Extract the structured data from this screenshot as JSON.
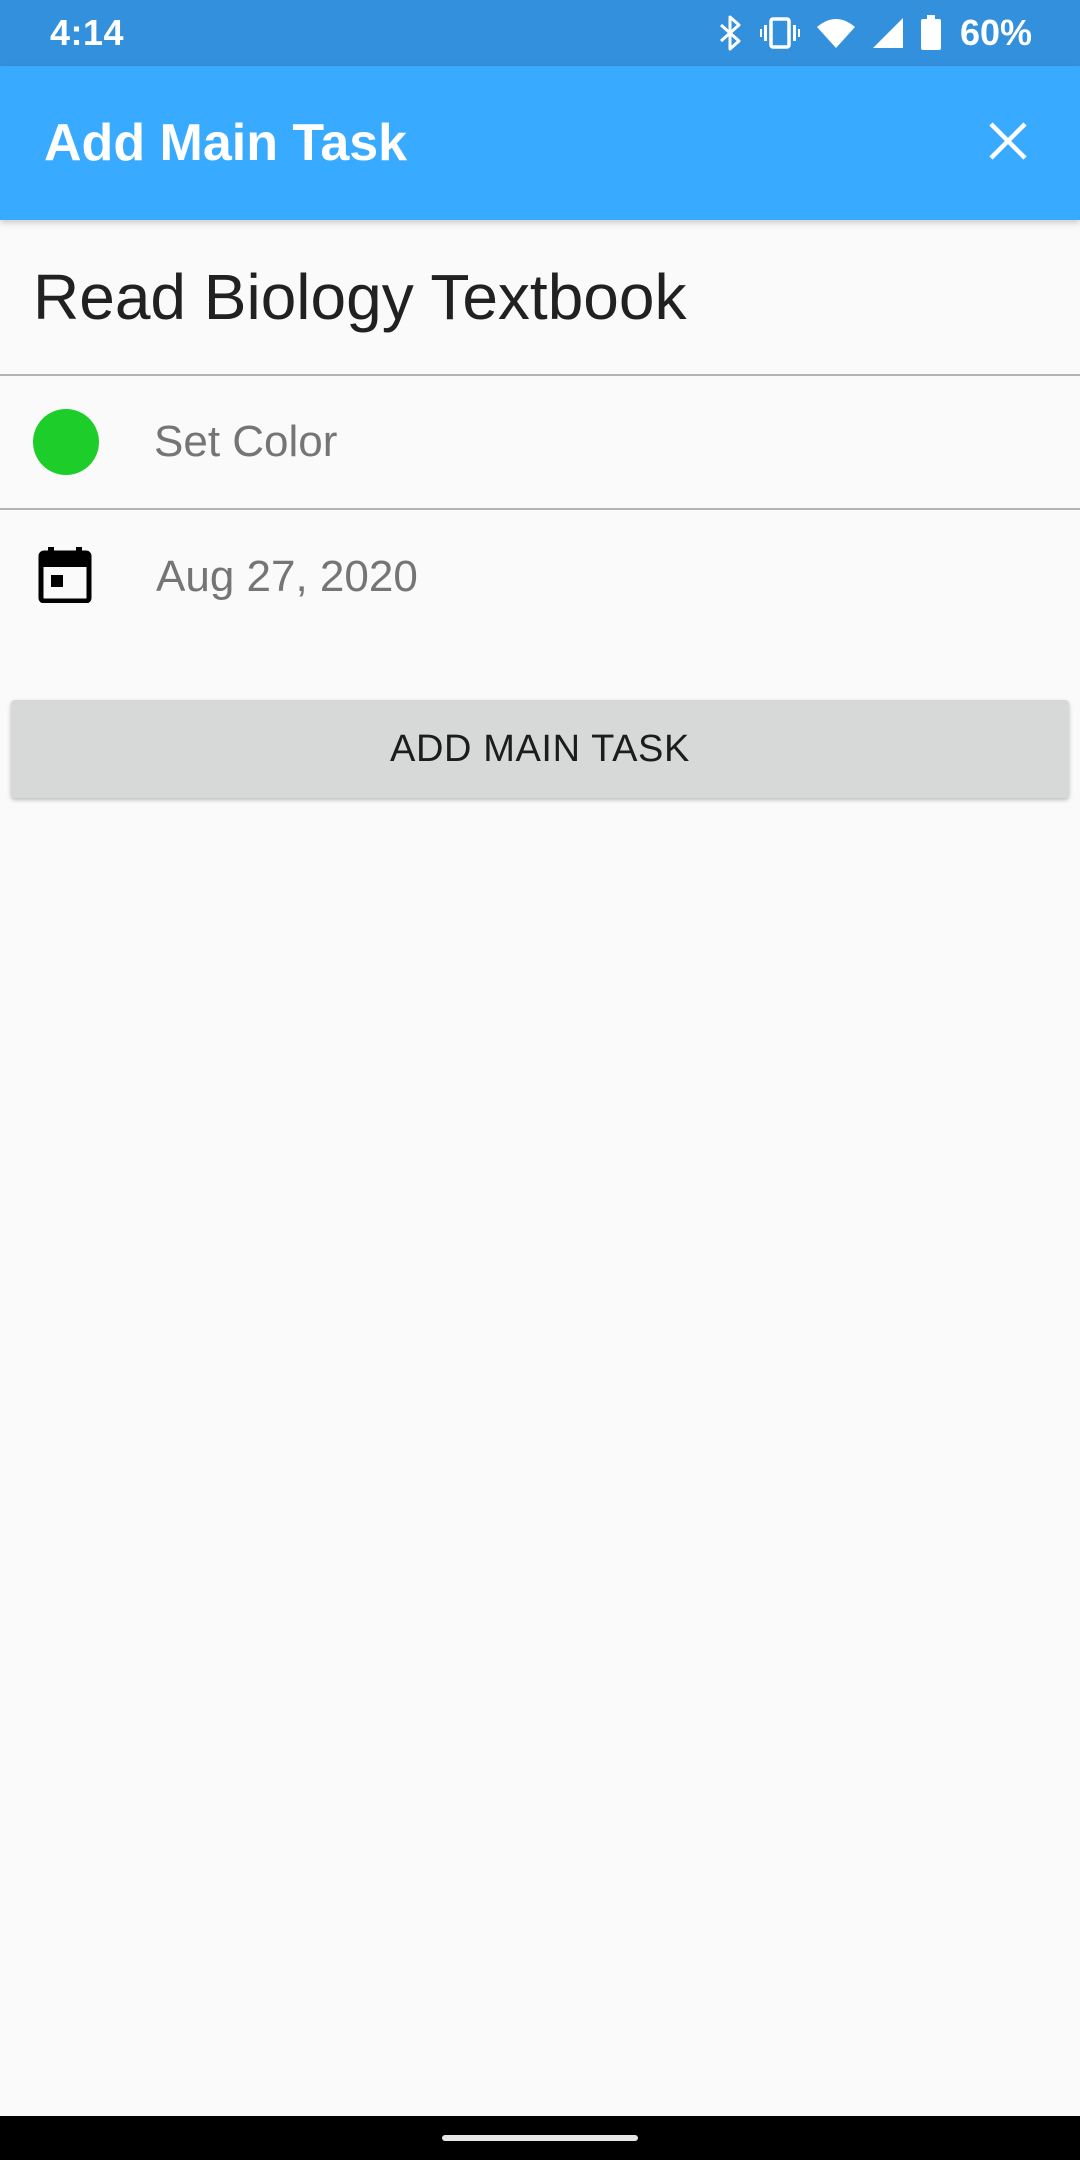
{
  "status_bar": {
    "time": "4:14",
    "battery": "60%",
    "icons": [
      "bluetooth-icon",
      "vibrate-icon",
      "wifi-icon",
      "signal-icon",
      "battery-icon"
    ]
  },
  "app_bar": {
    "title": "Add Main Task",
    "close_icon": "close-icon",
    "background": "#38aaff"
  },
  "form": {
    "task_name": "Read Biology Textbook",
    "color_label": "Set Color",
    "color_value": "#1dce2a",
    "date_icon": "calendar-icon",
    "date_value": "Aug 27, 2020"
  },
  "actions": {
    "add_label": "ADD MAIN TASK"
  }
}
